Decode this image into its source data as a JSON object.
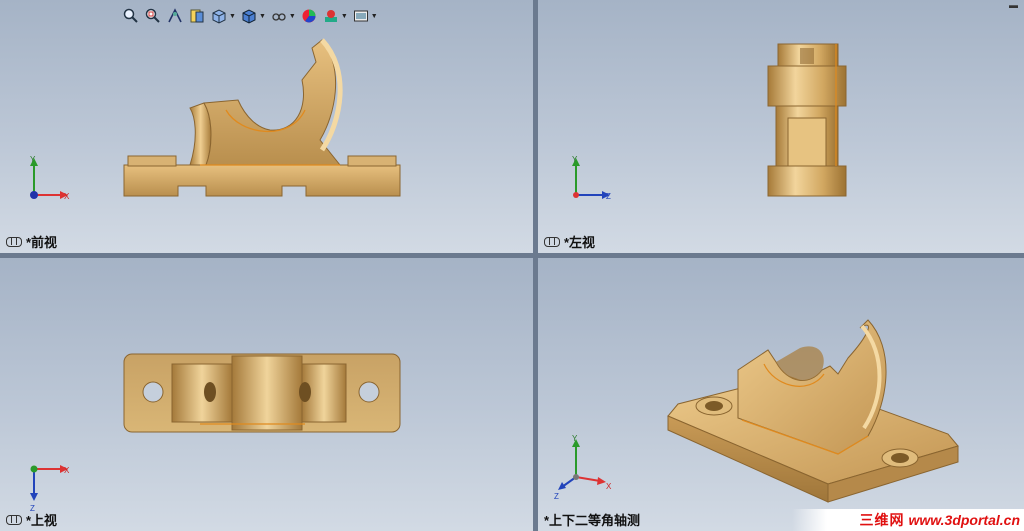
{
  "views": {
    "front": {
      "label": "*前视"
    },
    "left": {
      "label": "*左视"
    },
    "top": {
      "label": "*上视"
    },
    "iso": {
      "label": "*上下二等角轴测"
    }
  },
  "axes": {
    "x": "X",
    "y": "Y",
    "z": "Z"
  },
  "toolbar": {
    "icons": [
      "zoom-to-fit-icon",
      "zoom-area-icon",
      "previous-view-icon",
      "section-view-icon",
      "view-orientation-icon",
      "display-style-icon",
      "hide-show-icon",
      "edit-appearance-icon",
      "apply-scene-icon",
      "view-settings-icon"
    ]
  },
  "watermark": {
    "cn": "三维网",
    "url": "www.3dportal.cn"
  },
  "colors": {
    "part": "#c9a465",
    "edge": "#e08a1e",
    "background_top": "#a5b3c6",
    "background_bottom": "#d2dae4"
  }
}
